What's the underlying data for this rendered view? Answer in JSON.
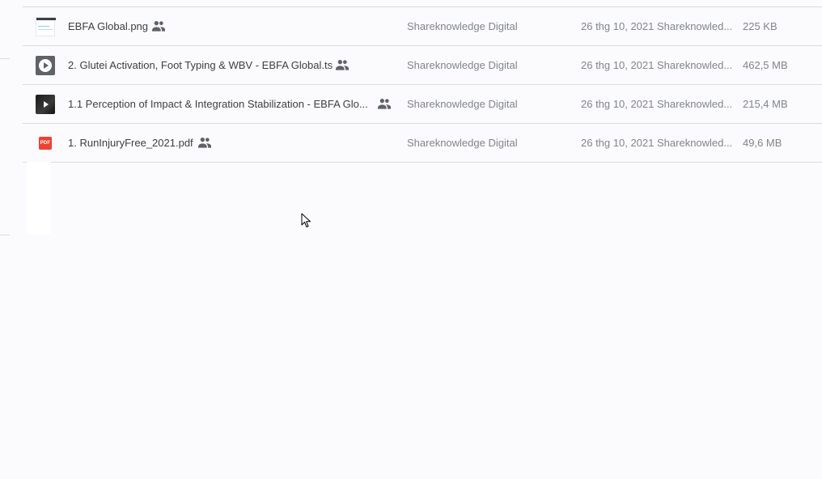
{
  "colors": {
    "background": "#fbfafc",
    "divider": "#dadce0",
    "primary_text": "#3c4043",
    "secondary_text": "#80868b",
    "pdf_red": "#ea4335"
  },
  "files": [
    {
      "name": "EBFA Global.png",
      "type_icon": "image-thumbnail-icon",
      "shared": true,
      "owner": "Shareknowledge Digital",
      "modified": "26 thg 10, 2021",
      "modified_by": "Shareknowled...",
      "size": "225 KB"
    },
    {
      "name": "2. Glutei Activation, Foot Typing & WBV - EBFA Global.ts",
      "type_icon": "video-play-icon",
      "shared": true,
      "owner": "Shareknowledge Digital",
      "modified": "26 thg 10, 2021",
      "modified_by": "Shareknowled...",
      "size": "462,5 MB"
    },
    {
      "name": "1.1 Perception of Impact & Integration Stabilization - EBFA Glo...",
      "type_icon": "video-play-icon",
      "shared": true,
      "owner": "Shareknowledge Digital",
      "modified": "26 thg 10, 2021",
      "modified_by": "Shareknowled...",
      "size": "215,4 MB"
    },
    {
      "name": "1. RunInjuryFree_2021.pdf",
      "type_icon": "pdf-file-icon",
      "type_icon_label": "PDF",
      "shared": true,
      "owner": "Shareknowledge Digital",
      "modified": "26 thg 10, 2021",
      "modified_by": "Shareknowled...",
      "size": "49,6 MB"
    }
  ]
}
